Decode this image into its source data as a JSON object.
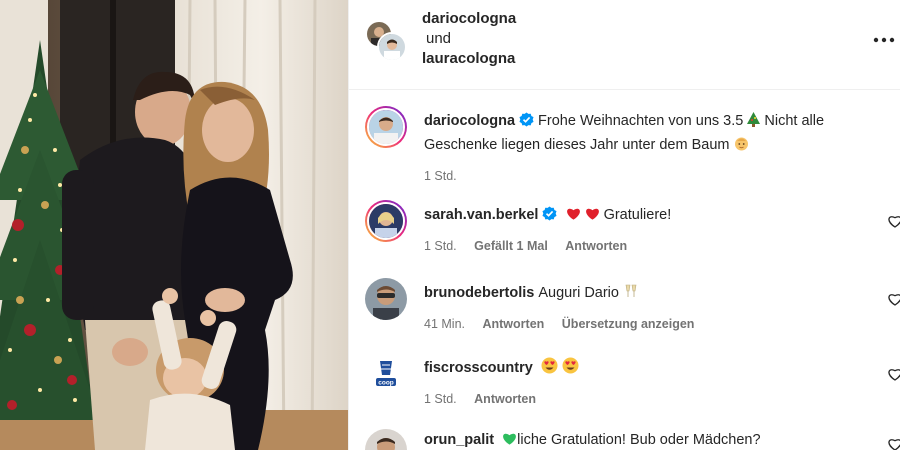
{
  "header": {
    "user1": "dariocologna",
    "connector": "und",
    "user2": "lauracologna",
    "more_icon": "more-horizontal-icon"
  },
  "caption": {
    "user": "dariocologna",
    "text1": "Frohe Weihnachten von uns 3.5",
    "text2": "Nicht alle Geschenke liegen dieses Jahr unter dem Baum",
    "time": "1 Std.",
    "icons": [
      "christmas-tree-emoji",
      "baby-emoji",
      "verified-badge-icon"
    ]
  },
  "comments": [
    {
      "user": "sarah.van.berkel",
      "text": "Gratuliere!",
      "time": "1 Std.",
      "likes": "Gefällt 1 Mal",
      "reply": "Antworten",
      "verified": true
    },
    {
      "user": "brunodebertolis",
      "text": "Auguri Dario",
      "time": "41 Min.",
      "reply": "Antworten",
      "translate": "Übersetzung anzeigen"
    },
    {
      "user": "fiscrosscountry",
      "text": "",
      "time": "1 Std.",
      "reply": "Antworten",
      "avatar_label": "coop"
    },
    {
      "user": "orun_palit",
      "text": "liche Gratulation! Bub oder Mädchen?"
    }
  ],
  "colors": {
    "verified": "#0095f6",
    "heart": "#ed4956",
    "meta": "#737373",
    "text": "#262626"
  }
}
